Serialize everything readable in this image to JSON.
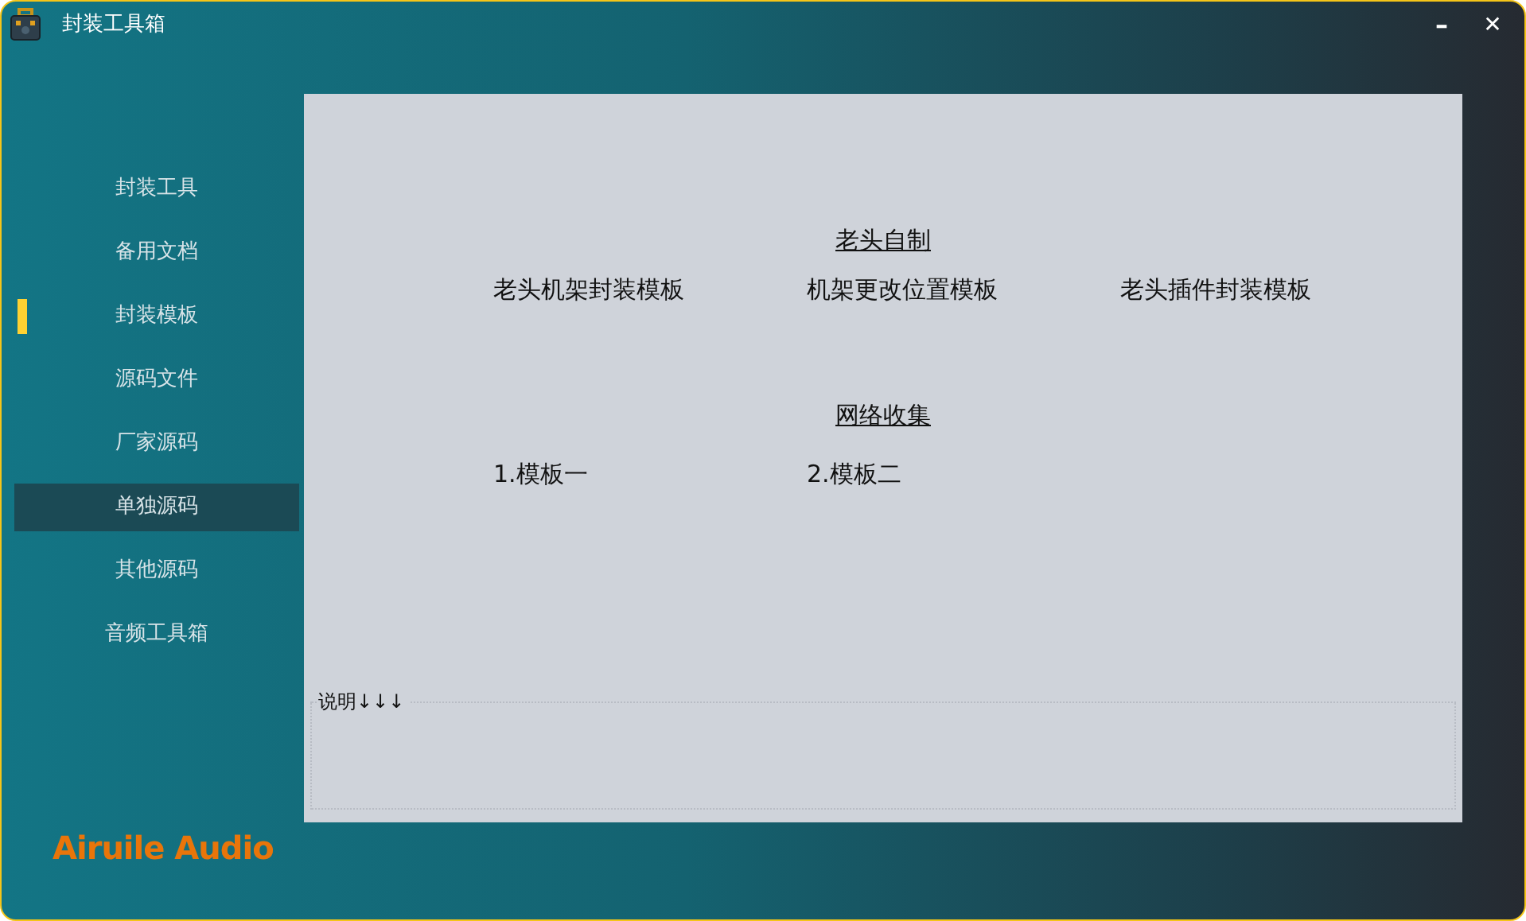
{
  "window": {
    "title": "封装工具箱",
    "controls": [
      {
        "kind": "minimize",
        "label": "–"
      },
      {
        "kind": "close",
        "label": "✕"
      }
    ]
  },
  "sidebar": {
    "items": [
      {
        "label": "封装工具",
        "selected": false,
        "highlighted": false
      },
      {
        "label": "备用文档",
        "selected": false,
        "highlighted": false
      },
      {
        "label": "封装模板",
        "selected": true,
        "highlighted": false
      },
      {
        "label": "源码文件",
        "selected": false,
        "highlighted": false
      },
      {
        "label": "厂家源码",
        "selected": false,
        "highlighted": false
      },
      {
        "label": "单独源码",
        "selected": false,
        "highlighted": true
      },
      {
        "label": "其他源码",
        "selected": false,
        "highlighted": false
      },
      {
        "label": "音频工具箱",
        "selected": false,
        "highlighted": false
      }
    ],
    "brand": "Airuile Audio"
  },
  "sections": [
    {
      "heading": "老头自制",
      "links": [
        "老头机架封装模板",
        "机架更改位置模板",
        "老头插件封装模板"
      ]
    },
    {
      "heading": "网络收集",
      "links": [
        "1.模板一",
        "2.模板二"
      ]
    }
  ],
  "notes": {
    "legend": "说明↓↓↓"
  }
}
